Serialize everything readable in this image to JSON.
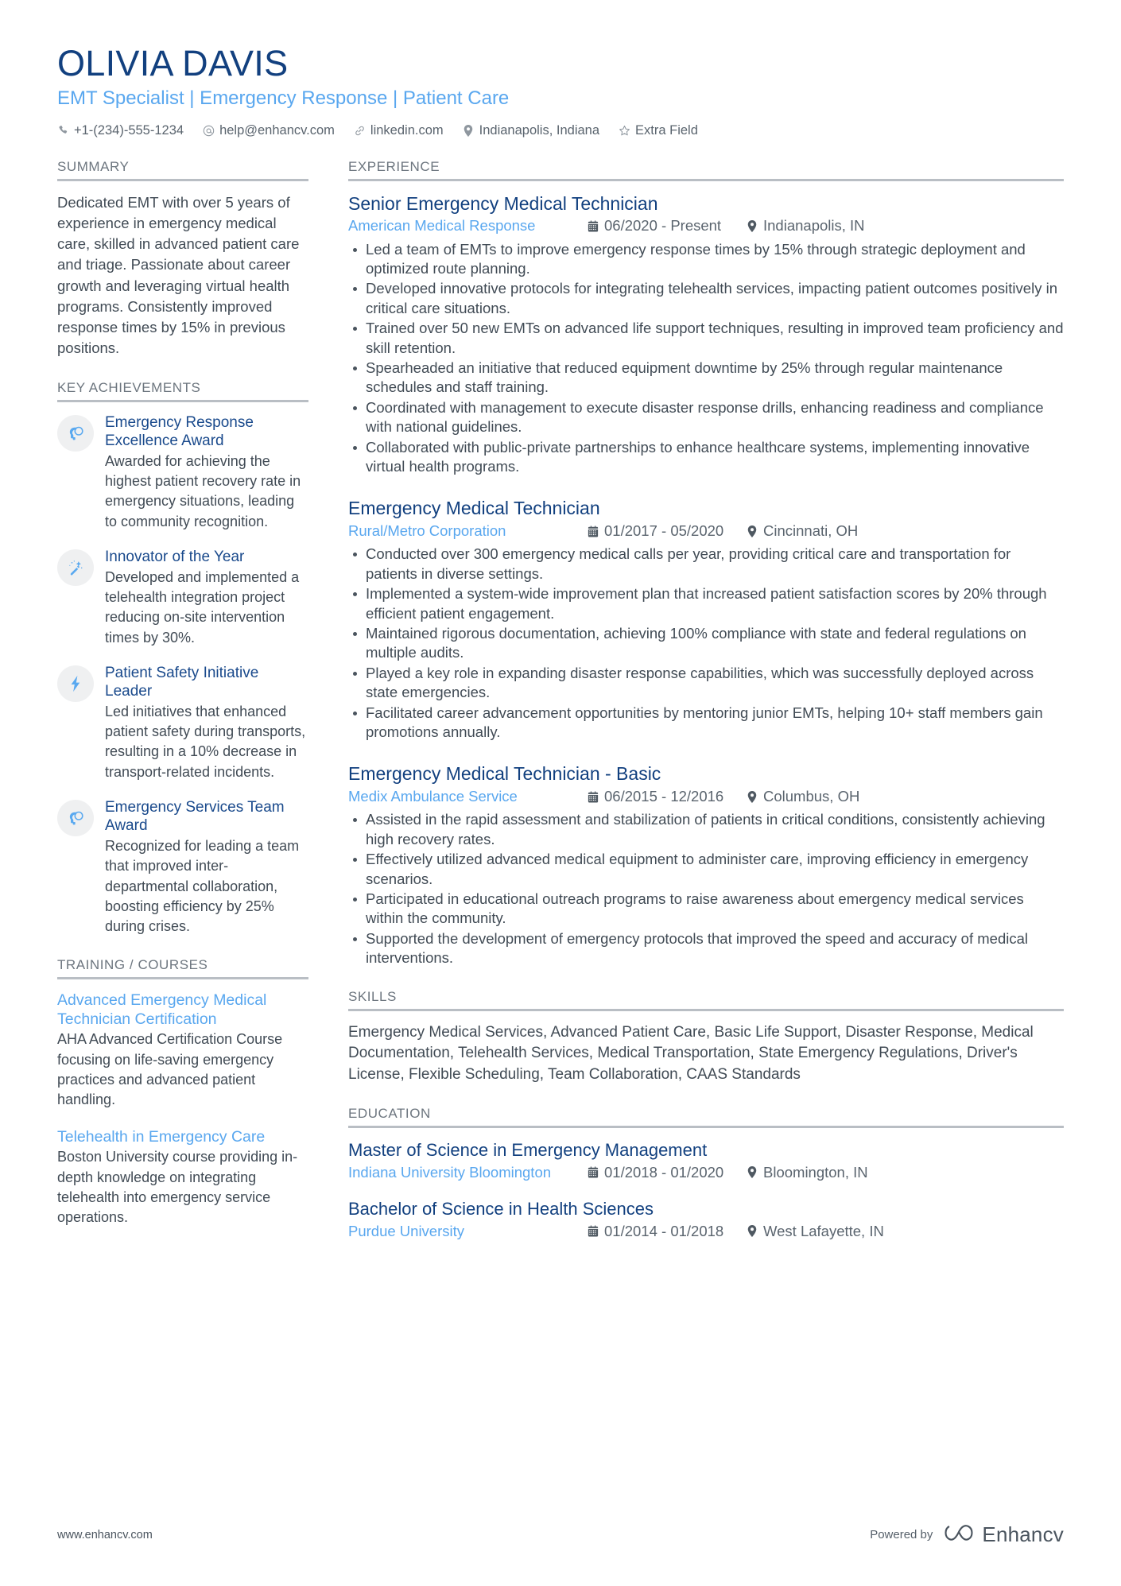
{
  "header": {
    "name": "OLIVIA DAVIS",
    "headline": "EMT Specialist | Emergency Response | Patient Care",
    "contacts": [
      {
        "icon": "phone-icon",
        "text": "+1-(234)-555-1234"
      },
      {
        "icon": "email-icon",
        "text": "help@enhancv.com"
      },
      {
        "icon": "link-icon",
        "text": "linkedin.com"
      },
      {
        "icon": "location-pin-icon",
        "text": "Indianapolis, Indiana"
      },
      {
        "icon": "star-icon",
        "text": "Extra Field"
      }
    ]
  },
  "summary": {
    "title": "SUMMARY",
    "text": "Dedicated EMT with over 5 years of experience in emergency medical care, skilled in advanced patient care and triage. Passionate about career growth and leveraging virtual health programs. Consistently improved response times by 15% in previous positions."
  },
  "achievements": {
    "title": "KEY ACHIEVEMENTS",
    "items": [
      {
        "icon": "head-thought-bubble-icon",
        "title": "Emergency Response Excellence Award",
        "desc": "Awarded for achieving the highest patient recovery rate in emergency situations, leading to community recognition."
      },
      {
        "icon": "magic-wand-icon",
        "title": "Innovator of the Year",
        "desc": "Developed and implemented a telehealth integration project reducing on-site intervention times by 30%."
      },
      {
        "icon": "lightning-bolt-icon",
        "title": "Patient Safety Initiative Leader",
        "desc": "Led initiatives that enhanced patient safety during transports, resulting in a 10% decrease in transport-related incidents."
      },
      {
        "icon": "head-thought-bubble-icon",
        "title": "Emergency Services Team Award",
        "desc": "Recognized for leading a team that improved inter-departmental collaboration, boosting efficiency by 25% during crises."
      }
    ]
  },
  "training": {
    "title": "TRAINING / COURSES",
    "items": [
      {
        "title": "Advanced Emergency Medical Technician Certification",
        "desc": "AHA Advanced Certification Course focusing on life-saving emergency practices and advanced patient handling."
      },
      {
        "title": "Telehealth in Emergency Care",
        "desc": "Boston University course providing in-depth knowledge on integrating telehealth into emergency service operations."
      }
    ]
  },
  "experience": {
    "title": "EXPERIENCE",
    "jobs": [
      {
        "title": "Senior Emergency Medical Technician",
        "company": "American Medical Response",
        "date": "06/2020 - Present",
        "location": "Indianapolis, IN",
        "bullets": [
          "Led a team of EMTs to improve emergency response times by 15% through strategic deployment and optimized route planning.",
          "Developed innovative protocols for integrating telehealth services, impacting patient outcomes positively in critical care situations.",
          "Trained over 50 new EMTs on advanced life support techniques, resulting in improved team proficiency and skill retention.",
          "Spearheaded an initiative that reduced equipment downtime by 25% through regular maintenance schedules and staff training.",
          "Coordinated with management to execute disaster response drills, enhancing readiness and compliance with national guidelines.",
          "Collaborated with public-private partnerships to enhance healthcare systems, implementing innovative virtual health programs."
        ]
      },
      {
        "title": "Emergency Medical Technician",
        "company": "Rural/Metro Corporation",
        "date": "01/2017 - 05/2020",
        "location": "Cincinnati, OH",
        "bullets": [
          "Conducted over 300 emergency medical calls per year, providing critical care and transportation for patients in diverse settings.",
          "Implemented a system-wide improvement plan that increased patient satisfaction scores by 20% through efficient patient engagement.",
          "Maintained rigorous documentation, achieving 100% compliance with state and federal regulations on multiple audits.",
          "Played a key role in expanding disaster response capabilities, which was successfully deployed across state emergencies.",
          "Facilitated career advancement opportunities by mentoring junior EMTs, helping 10+ staff members gain promotions annually."
        ]
      },
      {
        "title": "Emergency Medical Technician - Basic",
        "company": "Medix Ambulance Service",
        "date": "06/2015 - 12/2016",
        "location": "Columbus, OH",
        "bullets": [
          "Assisted in the rapid assessment and stabilization of patients in critical conditions, consistently achieving high recovery rates.",
          "Effectively utilized advanced medical equipment to administer care, improving efficiency in emergency scenarios.",
          "Participated in educational outreach programs to raise awareness about emergency medical services within the community.",
          "Supported the development of emergency protocols that improved the speed and accuracy of medical interventions."
        ]
      }
    ]
  },
  "skills": {
    "title": "SKILLS",
    "text": "Emergency Medical Services, Advanced Patient Care, Basic Life Support, Disaster Response, Medical Documentation, Telehealth Services, Medical Transportation, State Emergency Regulations, Driver's License, Flexible Scheduling, Team Collaboration, CAAS Standards"
  },
  "education": {
    "title": "EDUCATION",
    "items": [
      {
        "degree": "Master of Science in Emergency Management",
        "school": "Indiana University Bloomington",
        "date": "01/2018 - 01/2020",
        "location": "Bloomington, IN"
      },
      {
        "degree": "Bachelor of Science in Health Sciences",
        "school": "Purdue University",
        "date": "01/2014 - 01/2018",
        "location": "West Lafayette, IN"
      }
    ]
  },
  "footer": {
    "url": "www.enhancv.com",
    "powered_by": "Powered by",
    "brand": "Enhancv"
  },
  "colors": {
    "navy": "#12407f",
    "light_blue": "#59a7ef",
    "body_text": "#414b55",
    "muted": "#6d767f",
    "rule": "#b9bec4",
    "icon_bg": "#eff0f1"
  }
}
